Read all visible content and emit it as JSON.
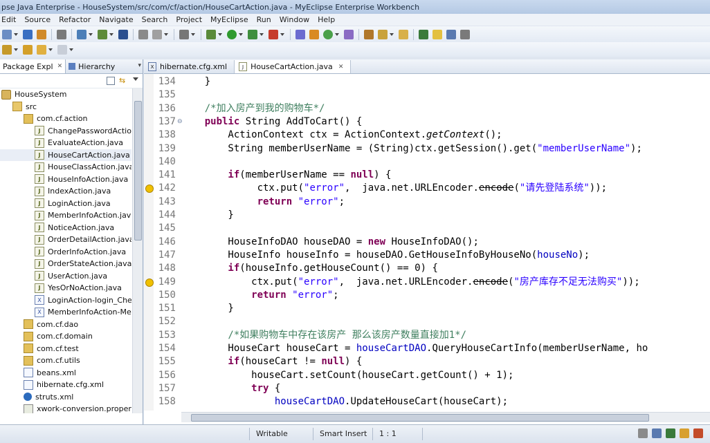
{
  "window": {
    "title": "pse Java Enterprise - HouseSystem/src/com/cf/action/HouseCartAction.java - MyEclipse Enterprise Workbench"
  },
  "menu": [
    "Edit",
    "Source",
    "Refactor",
    "Navigate",
    "Search",
    "Project",
    "MyEclipse",
    "Run",
    "Window",
    "Help"
  ],
  "left_panel": {
    "tabs": [
      {
        "label": "Package Expl"
      },
      {
        "label": "Hierarchy"
      }
    ],
    "tree": [
      {
        "label": "HouseSystem",
        "icon": "project-icon",
        "indent": 0
      },
      {
        "label": "src",
        "icon": "source-folder-icon",
        "indent": 1
      },
      {
        "label": "com.cf.action",
        "icon": "package-icon",
        "indent": 2
      },
      {
        "label": "ChangePasswordAction.j",
        "icon": "java-file-icon",
        "indent": 3
      },
      {
        "label": "EvaluateAction.java",
        "icon": "java-file-icon",
        "indent": 3
      },
      {
        "label": "HouseCartAction.java",
        "icon": "java-file-icon",
        "indent": 3,
        "selected": true
      },
      {
        "label": "HouseClassAction.java",
        "icon": "java-file-icon",
        "indent": 3
      },
      {
        "label": "HouseInfoAction.java",
        "icon": "java-file-icon",
        "indent": 3
      },
      {
        "label": "IndexAction.java",
        "icon": "java-file-icon",
        "indent": 3
      },
      {
        "label": "LoginAction.java",
        "icon": "java-file-icon",
        "indent": 3
      },
      {
        "label": "MemberInfoAction.java",
        "icon": "java-file-icon",
        "indent": 3
      },
      {
        "label": "NoticeAction.java",
        "icon": "java-file-icon",
        "indent": 3
      },
      {
        "label": "OrderDetailAction.java",
        "icon": "java-file-icon",
        "indent": 3
      },
      {
        "label": "OrderInfoAction.java",
        "icon": "java-file-icon",
        "indent": 3
      },
      {
        "label": "OrderStateAction.java",
        "icon": "java-file-icon",
        "indent": 3
      },
      {
        "label": "UserAction.java",
        "icon": "java-file-icon",
        "indent": 3
      },
      {
        "label": "YesOrNoAction.java",
        "icon": "java-file-icon",
        "indent": 3
      },
      {
        "label": "LoginAction-login_Check",
        "icon": "xml-file-icon",
        "indent": 3
      },
      {
        "label": "MemberInfoAction-Mem",
        "icon": "xml-file-icon",
        "indent": 3
      },
      {
        "label": "com.cf.dao",
        "icon": "package-icon",
        "indent": 2
      },
      {
        "label": "com.cf.domain",
        "icon": "package-icon",
        "indent": 2
      },
      {
        "label": "com.cf.test",
        "icon": "package-icon",
        "indent": 2
      },
      {
        "label": "com.cf.utils",
        "icon": "package-icon",
        "indent": 2
      },
      {
        "label": "beans.xml",
        "icon": "folder-icon",
        "indent": 2
      },
      {
        "label": "hibernate.cfg.xml",
        "icon": "folder-icon",
        "indent": 2
      },
      {
        "label": "struts.xml",
        "icon": "gear-icon",
        "indent": 2
      },
      {
        "label": "xwork-conversion.propertie",
        "icon": "properties-file-icon",
        "indent": 2
      }
    ]
  },
  "editor": {
    "tabs": [
      {
        "label": "hibernate.cfg.xml",
        "active": false
      },
      {
        "label": "HouseCartAction.java",
        "active": true
      }
    ],
    "lines": [
      {
        "n": "134",
        "parts": [
          [
            "t",
            "    }"
          ]
        ]
      },
      {
        "n": "135",
        "parts": []
      },
      {
        "n": "136",
        "parts": [
          [
            "c",
            "    /*加入房产到我的购物车*/"
          ]
        ]
      },
      {
        "n": "137",
        "fold": true,
        "parts": [
          [
            "k",
            "    public "
          ],
          [
            "t",
            "String AddToCart() {"
          ]
        ]
      },
      {
        "n": "138",
        "parts": [
          [
            "t",
            "        ActionContext ctx = ActionContext."
          ],
          [
            "i",
            "getContext"
          ],
          [
            "t",
            "();"
          ]
        ]
      },
      {
        "n": "139",
        "parts": [
          [
            "t",
            "        String memberUserName = (String)ctx.getSession().get("
          ],
          [
            "s",
            "\"memberUserName\""
          ],
          [
            "t",
            ");"
          ]
        ]
      },
      {
        "n": "140",
        "parts": []
      },
      {
        "n": "141",
        "parts": [
          [
            "k",
            "        if"
          ],
          [
            "t",
            "(memberUserName == "
          ],
          [
            "k",
            "null"
          ],
          [
            "t",
            ") {"
          ]
        ]
      },
      {
        "n": "142",
        "warn": true,
        "parts": [
          [
            "t",
            "             ctx.put("
          ],
          [
            "s",
            "\"error\""
          ],
          [
            "t",
            ",  java.net.URLEncoder."
          ],
          [
            "x",
            "encode"
          ],
          [
            "t",
            "("
          ],
          [
            "s",
            "\"请先登陆系统\""
          ],
          [
            "t",
            "));"
          ]
        ]
      },
      {
        "n": "143",
        "parts": [
          [
            "k",
            "             return "
          ],
          [
            "s",
            "\"error\""
          ],
          [
            "t",
            ";"
          ]
        ]
      },
      {
        "n": "144",
        "parts": [
          [
            "t",
            "        }"
          ]
        ]
      },
      {
        "n": "145",
        "parts": []
      },
      {
        "n": "146",
        "parts": [
          [
            "t",
            "        HouseInfoDAO houseDAO = "
          ],
          [
            "k",
            "new "
          ],
          [
            "t",
            "HouseInfoDAO();"
          ]
        ]
      },
      {
        "n": "147",
        "parts": [
          [
            "t",
            "        HouseInfo houseInfo = houseDAO.GetHouseInfoByHouseNo("
          ],
          [
            "f",
            "houseNo"
          ],
          [
            "t",
            ");"
          ]
        ]
      },
      {
        "n": "148",
        "parts": [
          [
            "k",
            "        if"
          ],
          [
            "t",
            "(houseInfo.getHouseCount() == 0) {"
          ]
        ]
      },
      {
        "n": "149",
        "warn": true,
        "parts": [
          [
            "t",
            "            ctx.put("
          ],
          [
            "s",
            "\"error\""
          ],
          [
            "t",
            ",  java.net.URLEncoder."
          ],
          [
            "x",
            "encode"
          ],
          [
            "t",
            "("
          ],
          [
            "s",
            "\"房产库存不足无法购买\""
          ],
          [
            "t",
            "));"
          ]
        ]
      },
      {
        "n": "150",
        "parts": [
          [
            "k",
            "            return "
          ],
          [
            "s",
            "\"error\""
          ],
          [
            "t",
            ";"
          ]
        ]
      },
      {
        "n": "151",
        "parts": [
          [
            "t",
            "        }"
          ]
        ]
      },
      {
        "n": "152",
        "parts": []
      },
      {
        "n": "153",
        "parts": [
          [
            "c",
            "        /*如果购物车中存在该房产 那么该房产数量直接加1*/"
          ]
        ]
      },
      {
        "n": "154",
        "parts": [
          [
            "t",
            "        HouseCart houseCart = "
          ],
          [
            "f",
            "houseCartDAO"
          ],
          [
            "t",
            ".QueryHouseCartInfo(memberUserName, ho"
          ]
        ]
      },
      {
        "n": "155",
        "parts": [
          [
            "k",
            "        if"
          ],
          [
            "t",
            "(houseCart != "
          ],
          [
            "k",
            "null"
          ],
          [
            "t",
            ") {"
          ]
        ]
      },
      {
        "n": "156",
        "parts": [
          [
            "t",
            "            houseCart.setCount(houseCart.getCount() + 1);"
          ]
        ]
      },
      {
        "n": "157",
        "parts": [
          [
            "k",
            "            try "
          ],
          [
            "t",
            "{"
          ]
        ]
      },
      {
        "n": "158",
        "parts": [
          [
            "t",
            "                "
          ],
          [
            "f",
            "houseCartDAO"
          ],
          [
            "t",
            ".UpdateHouseCart(houseCart);"
          ]
        ]
      }
    ]
  },
  "status": {
    "mode": "Writable",
    "insert": "Smart Insert",
    "position": "1 : 1"
  },
  "colors": {
    "keyword": "#7f0055",
    "string": "#2a00ff",
    "comment": "#3f7f5f",
    "field": "#0000c0"
  }
}
